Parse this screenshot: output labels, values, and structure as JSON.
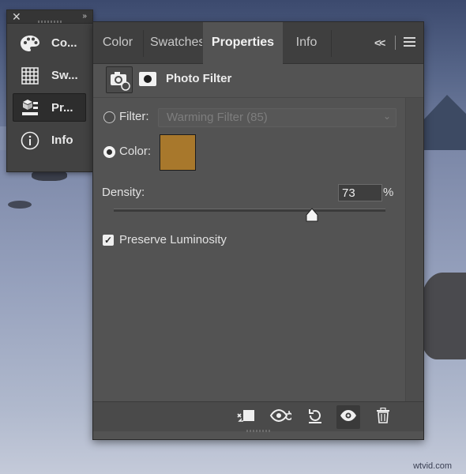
{
  "tool_panel": {
    "items": [
      {
        "label": "Co...",
        "icon": "palette-icon"
      },
      {
        "label": "Sw...",
        "icon": "swatches-grid-icon"
      },
      {
        "label": "Pr...",
        "icon": "properties-icon",
        "active": true
      },
      {
        "label": "Info",
        "icon": "info-icon"
      }
    ]
  },
  "tabs": [
    {
      "label": "Color"
    },
    {
      "label": "Swatches"
    },
    {
      "label": "Properties",
      "active": true
    },
    {
      "label": "Info"
    }
  ],
  "panel": {
    "title": "Photo Filter",
    "filter_label": "Filter:",
    "filter_value": "Warming Filter (85)",
    "color_label": "Color:",
    "color_swatch": "#a8782c",
    "density_label": "Density:",
    "density_value": "73",
    "density_unit": "%",
    "density_fraction": 0.73,
    "preserve_label": "Preserve Luminosity",
    "preserve_checked": true,
    "selected_option": "color"
  },
  "footer_buttons": [
    "clip-to-layer-icon",
    "view-previous-state-icon",
    "reset-icon",
    "visibility-eye-icon",
    "trash-icon"
  ],
  "watermark": "wtvid.com"
}
